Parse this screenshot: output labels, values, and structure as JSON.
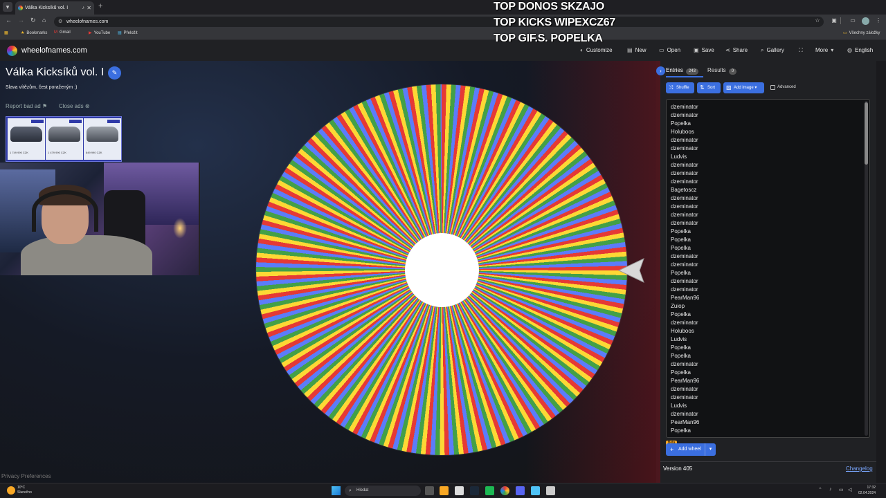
{
  "browser": {
    "tab_title": "Válka Kicksíků vol. I",
    "url": "wheelofnames.com",
    "bookmarks": [
      {
        "label": "Bookmarks"
      },
      {
        "label": "Gmail"
      },
      {
        "label": "YouTube"
      },
      {
        "label": "Přeložit"
      }
    ],
    "other_bookmarks": "Všechny záložky"
  },
  "header": {
    "brand": "wheelofnames.com",
    "menu": [
      "Customize",
      "New",
      "Open",
      "Save",
      "Share",
      "Gallery",
      "More",
      "English"
    ]
  },
  "wheel_info": {
    "title": "Válka Kicksíků vol. I",
    "description": "Slava vítězům, čest poraženým :)",
    "report_ad": "Report bad ad",
    "close_ads": "Close ads"
  },
  "ad": {
    "prices": [
      "1 749 990 CZK",
      "1 479 990 CZK",
      "849 990 CZK"
    ]
  },
  "overlay": {
    "lines": [
      "TOP DONOS SKZAJO",
      "TOP KICKS WIPEXCZ67",
      "TOP GIF.S.  POPELKA"
    ]
  },
  "panel": {
    "tab_entries": "Entries",
    "entries_count": "243",
    "tab_results": "Results",
    "results_count": "0",
    "shuffle": "Shuffle",
    "sort": "Sort",
    "add_image": "Add image",
    "advanced": "Advanced",
    "entries": [
      "dzeminator",
      "dzeminator",
      "Popelka",
      "Holuboos",
      "dzeminator",
      "dzeminator",
      "Ludvis",
      "dzeminator",
      "dzeminator",
      "dzeminator",
      "Bagetoscz",
      "dzeminator",
      "dzeminator",
      "dzeminator",
      "dzeminator",
      "Popelka",
      "Popelka",
      "Popelka",
      "dzeminator",
      "dzeminator",
      "Popelka",
      "dzeminator",
      "dzeminator",
      "PearMan96",
      "Zuiop",
      "Popelka",
      "dzeminator",
      "Holuboos",
      "Ludvis",
      "Popelka",
      "Popelka",
      "dzeminator",
      "Popelka",
      "PearMan96",
      "dzeminator",
      "dzeminator",
      "Ludvis",
      "dzeminator",
      "PearMan96",
      "Popelka"
    ],
    "beta": "Beta",
    "add_wheel": "Add wheel",
    "version": "Version 405",
    "changelog": "Changelog"
  },
  "footer": {
    "privacy": "Privacy Preferences"
  },
  "taskbar": {
    "temperature": "10°C",
    "weather": "Slunečno",
    "search_placeholder": "Hledat",
    "time": "17:32",
    "date": "02.04.2024"
  },
  "colors": {
    "accent": "#3b6fe0",
    "wheel_red": "#e53935",
    "wheel_yellow": "#fdd835",
    "wheel_green": "#43a047",
    "wheel_blue": "#5c7cfa"
  }
}
